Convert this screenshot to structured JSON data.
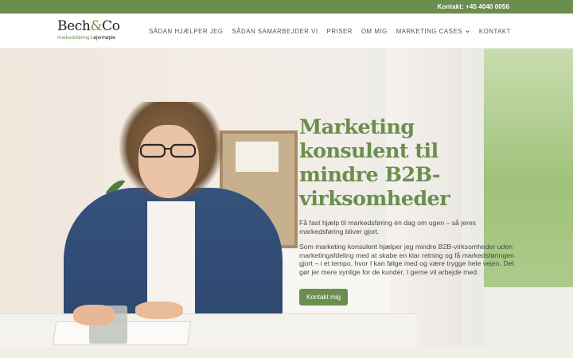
{
  "topbar": {
    "contact": "Kontakt: +45 4040 0056"
  },
  "logo": {
    "name_part1": "Bech",
    "ampersand": "&",
    "name_part2": "Co",
    "tagline_green": "markedsføring",
    "tagline_sep": " i ",
    "tagline_dark": "øjenhøjde"
  },
  "nav": {
    "items": [
      {
        "label": "SÅDAN HJÆLPER JEG"
      },
      {
        "label": "SÅDAN SAMARBEJDER VI"
      },
      {
        "label": "PRISER"
      },
      {
        "label": "OM MIG"
      },
      {
        "label": "MARKETING CASES",
        "icon": "chevron-down-icon"
      },
      {
        "label": "KONTAKT"
      }
    ]
  },
  "hero": {
    "title": "Marketing konsulent til mindre B2B-virksomheder",
    "paragraph1": "Få fast hjælp til markedsføring én dag om ugen – så jeres markedsføring bliver gjort.",
    "paragraph2": "Som marketing konsulent hjælper jeg mindre B2B-virksomheder uden marketingafdeling med at skabe en klar retning og få markedsføringen gjort – i et tempo, hvor I kan følge med og være trygge hele vejen. Det gør jer mere synlige for de kunder, I gerne vil arbejde med.",
    "cta_label": "Kontakt mig"
  },
  "colors": {
    "brand_green": "#6b8e4e",
    "text_gray": "#4a4a4a",
    "nav_gray": "#555555"
  }
}
